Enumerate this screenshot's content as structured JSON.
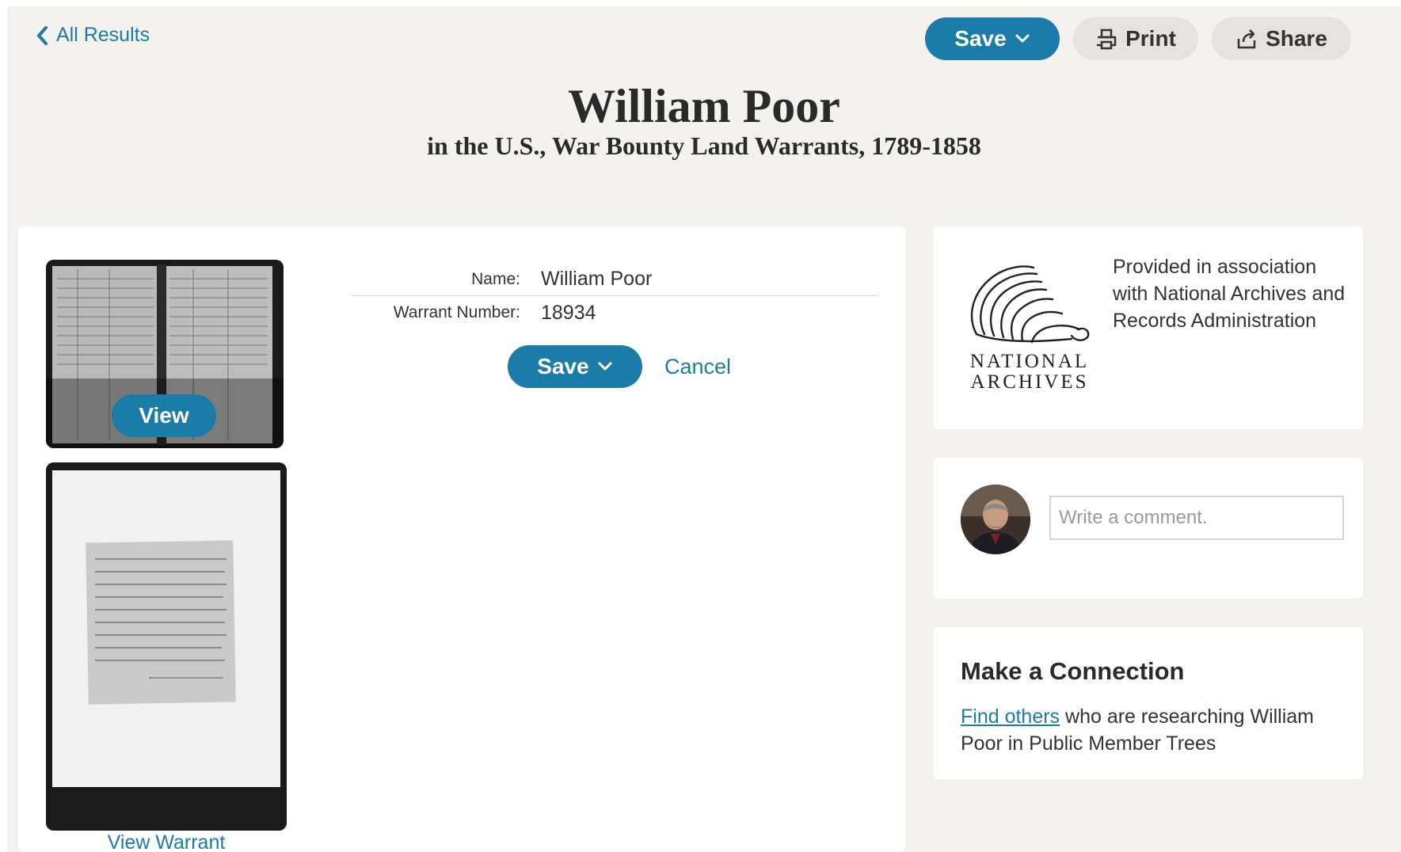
{
  "nav": {
    "back_label": "All Results"
  },
  "toolbar": {
    "save_label": "Save",
    "print_label": "Print",
    "share_label": "Share"
  },
  "header": {
    "title": "William Poor",
    "subtitle": "in the U.S., War Bounty Land Warrants, 1789-1858"
  },
  "images": {
    "view_label": "View",
    "view_warrant_label": "View Warrant"
  },
  "record": {
    "fields": [
      {
        "label": "Name:",
        "value": "William Poor"
      },
      {
        "label": "Warrant Number:",
        "value": "18934"
      }
    ],
    "save_label": "Save",
    "cancel_label": "Cancel"
  },
  "archives": {
    "logo_line1": "NATIONAL",
    "logo_line2": "ARCHIVES",
    "association_text": "Provided in association with National Archives and Records Administration"
  },
  "comment": {
    "placeholder": "Write a comment."
  },
  "connection": {
    "title": "Make a Connection",
    "link_text": "Find others",
    "rest_text": " who are researching William Poor in Public Member Trees"
  },
  "colors": {
    "accent": "#1b7ba9",
    "page_bg": "#f4f2ef",
    "light_button": "#e6e3df"
  },
  "icons": {
    "back": "chevron-left-icon",
    "save_menu": "chevron-down-icon",
    "print": "printer-icon",
    "share": "share-icon"
  }
}
